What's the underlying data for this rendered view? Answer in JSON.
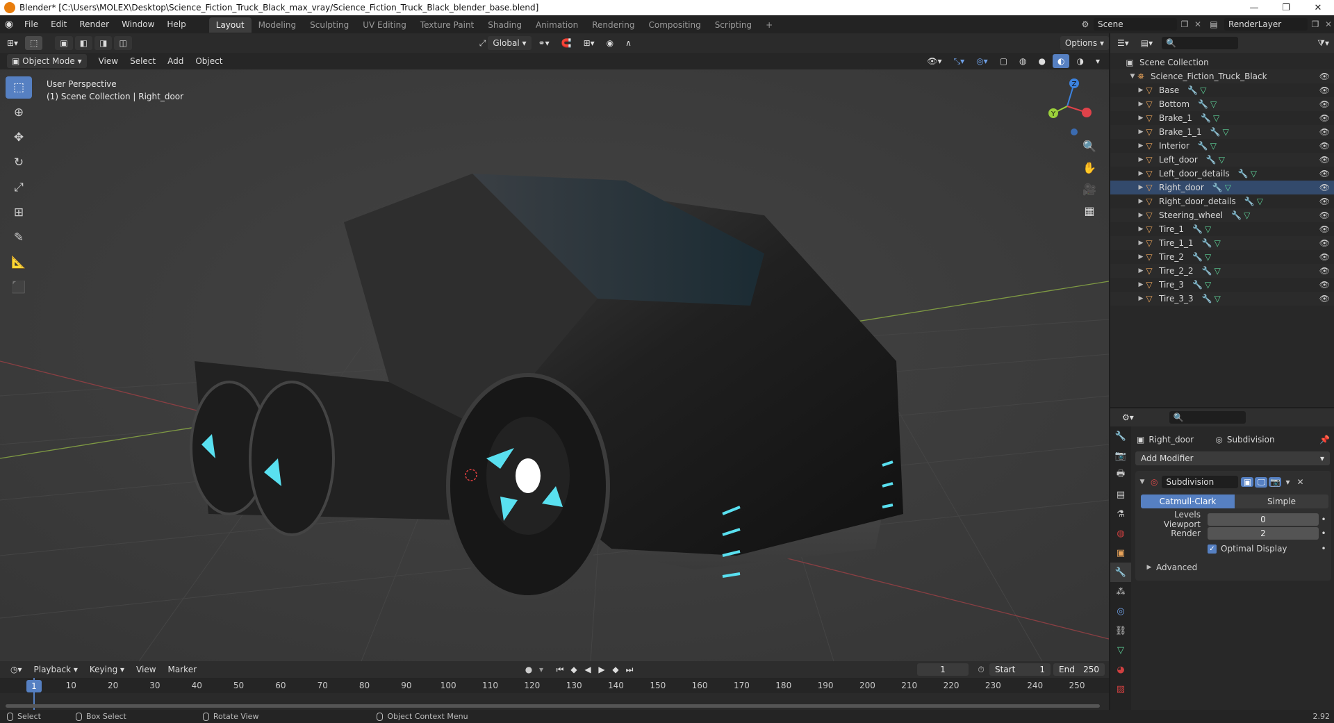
{
  "window": {
    "title": "Blender* [C:\\Users\\MOLEX\\Desktop\\Science_Fiction_Truck_Black_max_vray/Science_Fiction_Truck_Black_blender_base.blend]",
    "controls": [
      "—",
      "❐",
      "✕"
    ]
  },
  "menubar": {
    "menus": [
      "File",
      "Edit",
      "Render",
      "Window",
      "Help"
    ],
    "workspaces": [
      "Layout",
      "Modeling",
      "Sculpting",
      "UV Editing",
      "Texture Paint",
      "Shading",
      "Animation",
      "Rendering",
      "Compositing",
      "Scripting"
    ],
    "active_workspace": "Layout",
    "add_workspace": "+",
    "scene": "Scene",
    "render_layer": "RenderLayer"
  },
  "tool_header": {
    "transform_orientation": "Global",
    "options_label": "Options"
  },
  "viewport_header": {
    "mode": "Object Mode",
    "menus": [
      "View",
      "Select",
      "Add",
      "Object"
    ]
  },
  "viewport": {
    "perspective": "User Perspective",
    "context": "(1) Scene Collection | Right_door",
    "gizmo_axes": {
      "z": "Z",
      "y": "Y",
      "x": "X"
    },
    "colors": {
      "x_axis": "#e0424a",
      "y_axis": "#9bd13b",
      "z_axis": "#3c83e0",
      "accent": "#5680c2",
      "glow": "#59e0f0"
    }
  },
  "tools": [
    "select-box",
    "cursor",
    "move",
    "rotate",
    "scale",
    "transform",
    "annotate",
    "measure",
    "add-cube"
  ],
  "outliner": {
    "root": "Scene Collection",
    "collection": "Science_Fiction_Truck_Black",
    "objects": [
      "Base",
      "Bottom",
      "Brake_1",
      "Brake_1_1",
      "Interior",
      "Left_door",
      "Left_door_details",
      "Right_door",
      "Right_door_details",
      "Steering_wheel",
      "Tire_1",
      "Tire_1_1",
      "Tire_2",
      "Tire_2_2",
      "Tire_3",
      "Tire_3_3"
    ],
    "selected": "Right_door"
  },
  "properties": {
    "object_name": "Right_door",
    "modifier_context": "Subdivision",
    "add_modifier": "Add Modifier",
    "modifier": {
      "name": "Subdivision",
      "type_options": [
        "Catmull-Clark",
        "Simple"
      ],
      "active_type": "Catmull-Clark",
      "levels_viewport_label": "Levels Viewport",
      "levels_viewport": "0",
      "render_label": "Render",
      "render": "2",
      "optimal_display_label": "Optimal Display",
      "optimal_display": true,
      "advanced_label": "Advanced"
    }
  },
  "timeline": {
    "menus": [
      "Playback",
      "Keying",
      "View",
      "Marker"
    ],
    "current_frame": "1",
    "start_label": "Start",
    "start": "1",
    "end_label": "End",
    "end": "250",
    "ticks": [
      "1",
      "10",
      "20",
      "30",
      "40",
      "50",
      "60",
      "70",
      "80",
      "90",
      "100",
      "110",
      "120",
      "130",
      "140",
      "150",
      "160",
      "170",
      "180",
      "190",
      "200",
      "210",
      "220",
      "230",
      "240",
      "250"
    ]
  },
  "statusbar": {
    "items": [
      "Select",
      "Box Select",
      "Rotate View",
      "Object Context Menu"
    ],
    "version": "2.92"
  }
}
